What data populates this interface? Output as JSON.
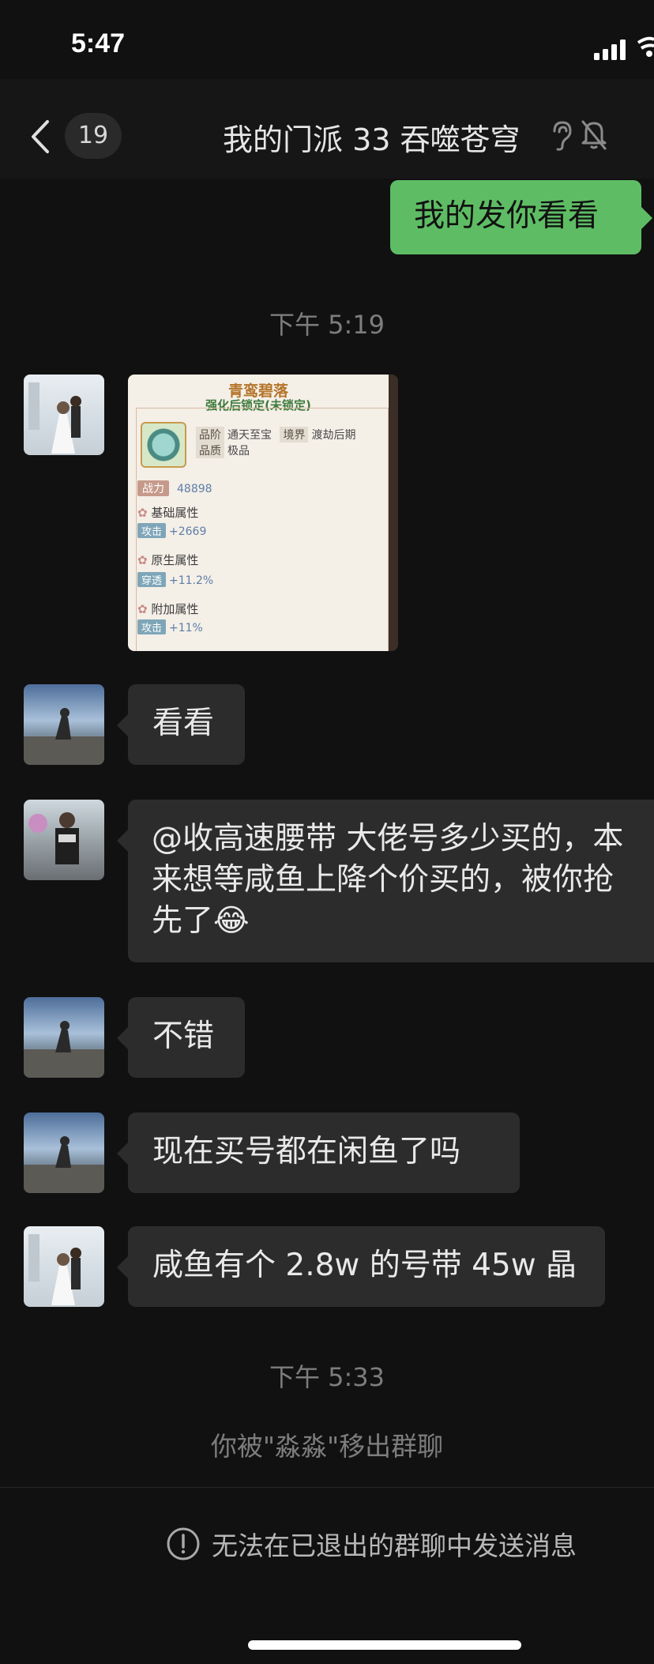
{
  "status_bar": {
    "time": "5:47"
  },
  "nav": {
    "unread_count": "19",
    "title": "我的门派 33 吞噬苍穹"
  },
  "messages": {
    "outgoing_1": "我的发你看看",
    "time_1": "下午 5:19",
    "incoming_1": "看看",
    "incoming_2": "@收高速腰带 大佬号多少买的，本来想等咸鱼上降个价买的，被你抢先了😂",
    "incoming_3": "不错",
    "incoming_4": "现在买号都在闲鱼了吗",
    "incoming_5": "咸鱼有个 2.8w 的号带 45w 晶",
    "time_2": "下午 5:33",
    "system_notice": "你被\"淼淼\"移出群聊"
  },
  "game_card": {
    "title": "青鸾碧落",
    "lock_status": "强化后锁定(未锁定)",
    "rank_label": "品阶",
    "rank_value": "通天至宝",
    "realm_label": "境界",
    "realm_value": "渡劫后期",
    "quality_label": "品质",
    "quality_value": "极品",
    "power_label": "战力",
    "power_value": "48898",
    "base_attr": "基础属性",
    "base_stat_label": "攻击",
    "base_stat_value": "+2669",
    "native_attr": "原生属性",
    "native_stat_label": "穿透",
    "native_stat_value": "+11.2%",
    "extra_attr": "附加属性",
    "extra_stat_label": "攻击",
    "extra_stat_value": "+11%",
    "icon_tag": "仙"
  },
  "footer": {
    "notice": "无法在已退出的群聊中发送消息"
  },
  "colors": {
    "background": "#111111",
    "outgoing_bubble": "#5ebd64",
    "incoming_bubble": "#2c2c2c"
  }
}
